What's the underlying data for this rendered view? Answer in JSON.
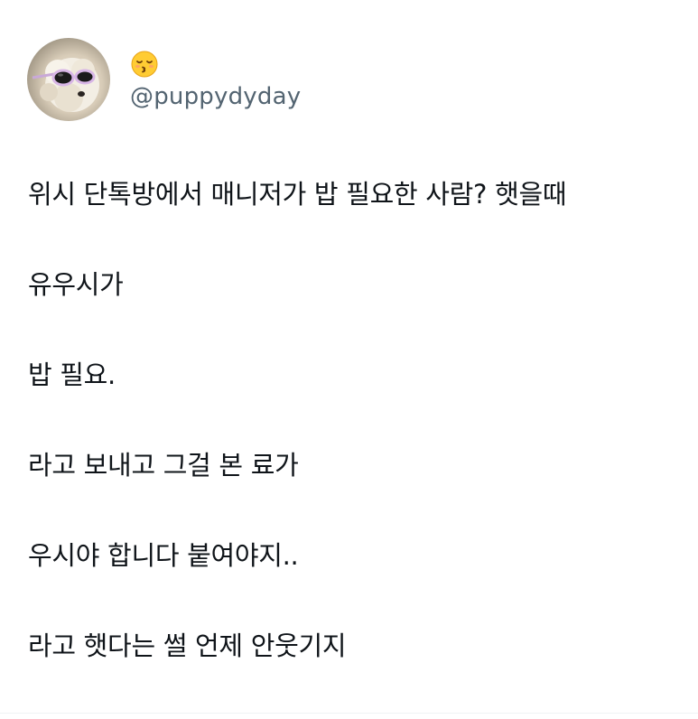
{
  "profile": {
    "display_name_icon": "kissing-face-with-closed-eyes-icon",
    "handle": "@puppydyday",
    "avatar_icon": "dog-with-sunglasses-avatar"
  },
  "tweet": {
    "lines": [
      "위시 단톡방에서 매니저가 밥 필요한 사람? 햇을때",
      "유우시가",
      "밥 필요.",
      "라고 보내고 그걸 본 료가",
      "우시야 합니다 붙여야지..",
      "라고 햇다는 썰 언제 안웃기지"
    ]
  },
  "colors": {
    "text": "#0f1419",
    "handle": "#536471",
    "emoji": "#ffcc33"
  }
}
